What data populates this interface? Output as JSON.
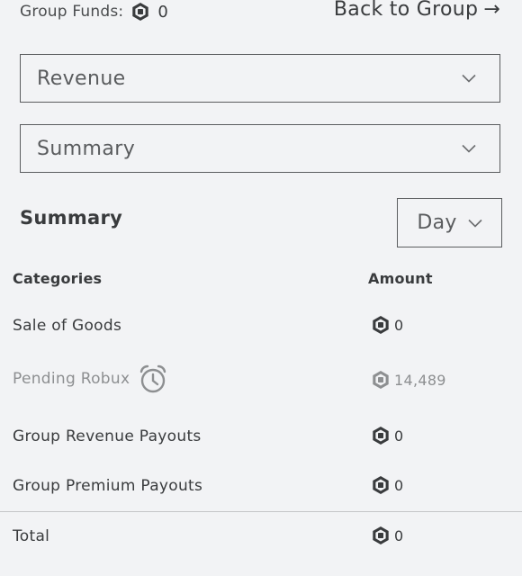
{
  "header": {
    "funds_label": "Group Funds:",
    "funds_value": "0",
    "back_link": "Back to Group",
    "back_arrow": "→"
  },
  "filters": {
    "type_selected": "Revenue",
    "view_selected": "Summary"
  },
  "summary": {
    "title": "Summary",
    "period_selected": "Day",
    "columns": {
      "category": "Categories",
      "amount": "Amount"
    },
    "rows": [
      {
        "label": "Sale of Goods",
        "amount": "0",
        "pending": false
      },
      {
        "label": "Pending Robux",
        "amount": "14,489",
        "pending": true
      },
      {
        "label": "Group Revenue Payouts",
        "amount": "0",
        "pending": false
      },
      {
        "label": "Group Premium Payouts",
        "amount": "0",
        "pending": false
      }
    ],
    "total": {
      "label": "Total",
      "amount": "0"
    }
  },
  "icons": {
    "currency": "robux-icon",
    "pending": "clock-icon",
    "dropdown": "chevron-down-icon"
  },
  "colors": {
    "background": "#f2f3f5",
    "text": "#393b3d",
    "muted": "#8d8f91",
    "border": "#5b5d5f"
  }
}
